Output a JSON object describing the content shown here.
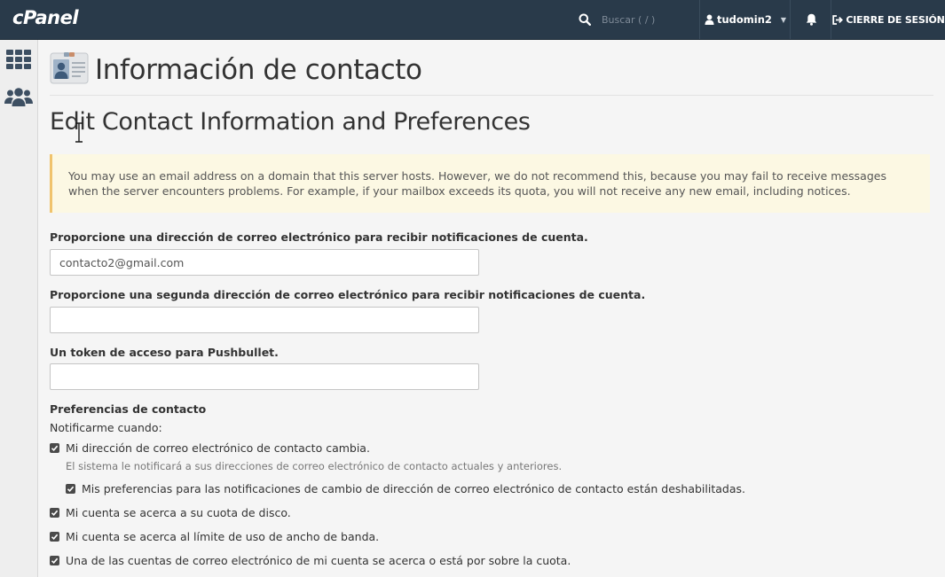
{
  "topbar": {
    "logo": "cPanel",
    "search_placeholder": "Buscar ( / )",
    "username": "tudomin2",
    "logout_label": "CIERRE DE SESIÓN"
  },
  "sidebar": {
    "items": [
      {
        "icon": "grid-icon"
      },
      {
        "icon": "users-icon"
      }
    ]
  },
  "header": {
    "title": "Información de contacto"
  },
  "main": {
    "section_title": "Edit Contact Information and Preferences",
    "alert_text": "You may use an email address on a domain that this server hosts. However, we do not recommend this, because you may fail to receive messages when the server encounters problems. For example, if your mailbox exceeds its quota, you will not receive any new email, including notices.",
    "fields": [
      {
        "label": "Proporcione una dirección de correo electrónico para recibir notificaciones de cuenta.",
        "value": "contacto2@gmail.com"
      },
      {
        "label": "Proporcione una segunda dirección de correo electrónico para recibir notificaciones de cuenta.",
        "value": ""
      },
      {
        "label": "Un token de acceso para Pushbullet.",
        "value": ""
      }
    ],
    "preferences": {
      "title": "Preferencias de contacto",
      "notify_label": "Notificarme cuando:",
      "options": [
        {
          "label": "Mi dirección de correo electrónico de contacto cambia.",
          "checked": true
        },
        {
          "label": "Mis preferencias para las notificaciones de cambio de dirección de correo electrónico de contacto están deshabilitadas.",
          "checked": true
        },
        {
          "label": "Mi cuenta se acerca a su cuota de disco.",
          "checked": true
        },
        {
          "label": "Mi cuenta se acerca al límite de uso de ancho de banda.",
          "checked": true
        },
        {
          "label": "Una de las cuentas de correo electrónico de mi cuenta se acerca o está por sobre la cuota.",
          "checked": true
        }
      ],
      "help_text": "El sistema le notificará a sus direcciones de correo electrónico de contacto actuales y anteriores."
    }
  },
  "colors": {
    "topbar_bg": "#293a4a",
    "alert_bg": "#fcf8e3",
    "alert_border": "#f0c36d"
  }
}
